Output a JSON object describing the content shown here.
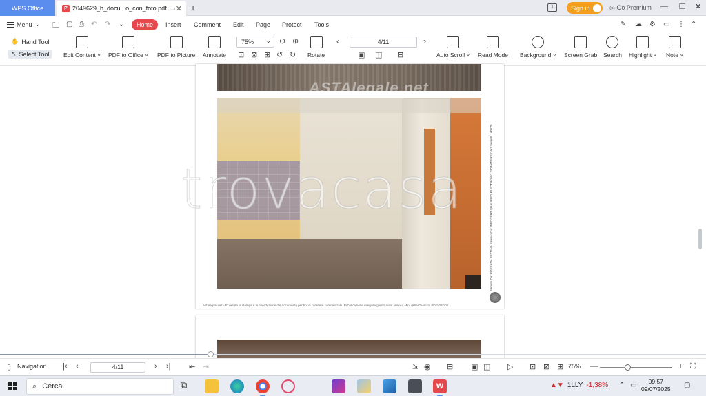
{
  "titlebar": {
    "app_tab": "WPS Office",
    "doc_tab": "2049629_b_docu...o_con_foto.pdf",
    "sign_in": "Sign in",
    "go_premium": "Go Premium"
  },
  "menu": {
    "menu_label": "Menu",
    "items": [
      "Home",
      "Insert",
      "Comment",
      "Edit",
      "Page",
      "Protect",
      "Tools"
    ]
  },
  "ribbon": {
    "hand_tool": "Hand Tool",
    "select_tool": "Select Tool",
    "edit_content": "Edit Content ˅",
    "pdf_to_office": "PDF to Office ˅",
    "pdf_to_picture": "PDF to Picture",
    "annotate": "Annotate",
    "zoom": "75%",
    "rotate": "Rotate",
    "page_indicator": "4/11",
    "auto_scroll": "Auto Scroll ˅",
    "read_mode": "Read Mode",
    "background": "Background ˅",
    "screen_grab": "Screen Grab",
    "search": "Search",
    "highlight": "Highlight ˅",
    "note": "Note ˅"
  },
  "document": {
    "watermark_asta": "ASTAlegale.net",
    "watermark_trovacasa": "trovacasa",
    "side_text": "Firmato Da: ROSSANA BETTINA Emesso Da: INFOCERT QUALIFIED ELECTRONIC SIGNATURE CA 3 Serial#: 1d0275",
    "footer_text": "Astalegale.net - E' vietata la stampa e la riproduzione del documento per fini di carattere commerciale. Pubblicazione eseguita giusto autor. alenco Min. della Giustizia PDG 08/105..."
  },
  "statusbar": {
    "navigation": "Navigation",
    "page": "4/11",
    "zoom": "75%",
    "zoom_fraction": 0.38
  },
  "taskbar": {
    "search_placeholder": "Cerca",
    "stock_name": "1LLY",
    "stock_change": "-1,38%",
    "time": "09:57",
    "date": "09/07/2025"
  },
  "colors": {
    "accent_blue": "#5b8def",
    "home_red": "#e5484d",
    "signin_orange": "#f59e1b"
  }
}
